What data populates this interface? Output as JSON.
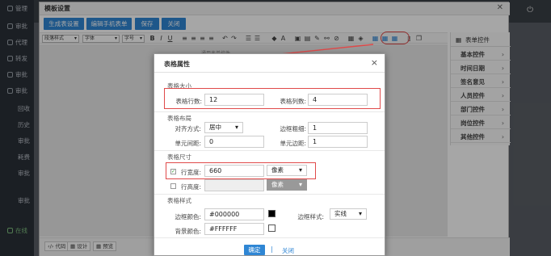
{
  "sidebar": {
    "items": [
      "管理",
      "审批",
      "代理",
      "转发",
      "审批",
      "审批",
      "回收",
      "历史",
      "审批",
      "耗费",
      "审批",
      "审批",
      "在线"
    ]
  },
  "template_window": {
    "title": "模板设置",
    "buttons": [
      "生成表设置",
      "编辑手机表单",
      "保存",
      "关闭"
    ],
    "toolbar_selects": [
      "段落样式",
      "字体",
      "字号"
    ],
    "toolbar_icons": [
      "B",
      "I",
      "U"
    ],
    "canvas_label": "通用表单控件",
    "right_panel_title": "表单控件",
    "right_panel_items": [
      "基本控件",
      "时间日期",
      "签名意见",
      "人员控件",
      "部门控件",
      "岗位控件",
      "其他控件"
    ],
    "bottom_buttons": [
      "代码",
      "设计",
      "预览"
    ]
  },
  "dialog": {
    "title": "表格属性",
    "close": "×",
    "size_section": "表格大小",
    "rows_label": "表格行数:",
    "rows_value": "12",
    "cols_label": "表格列数:",
    "cols_value": "4",
    "layout_section": "表格布局",
    "align_label": "对齐方式:",
    "align_value": "居中",
    "border_width_label": "边框粗细:",
    "border_width_value": "1",
    "cell_spacing_label": "单元间距:",
    "cell_spacing_value": "0",
    "cell_padding_label": "单元边距:",
    "cell_padding_value": "1",
    "dimension_section": "表格尺寸",
    "width_label": "行宽度:",
    "width_value": "660",
    "width_unit": "像素",
    "height_label": "行高度:",
    "height_value": "",
    "height_unit": "像素",
    "style_section": "表格样式",
    "border_color_label": "边框颜色:",
    "border_color_value": "#000000",
    "border_style_label": "边框样式:",
    "border_style_value": "实线",
    "bg_color_label": "背景颜色:",
    "bg_color_value": "#FFFFFF",
    "ok": "确定",
    "separator": "|",
    "cancel": "关闭"
  },
  "colors": {
    "accent": "#2f86d4",
    "highlight": "#e04a4a"
  }
}
